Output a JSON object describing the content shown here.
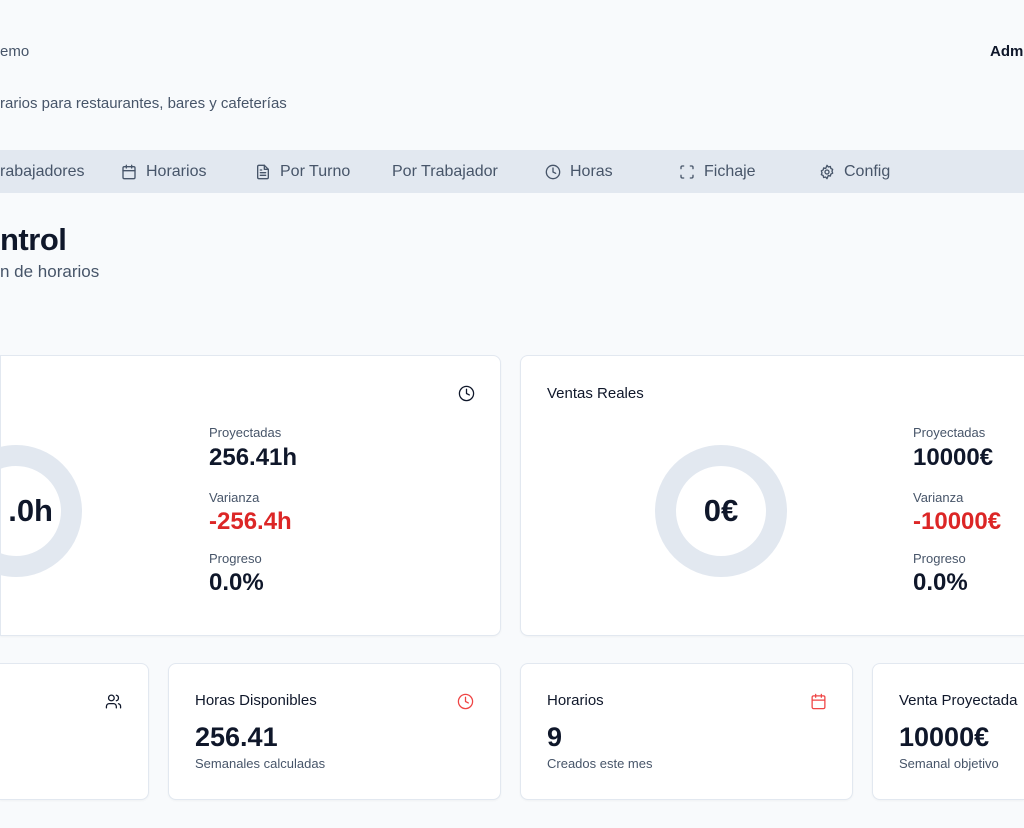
{
  "header": {
    "app_name_fragment": "emo",
    "user_fragment": "Adm",
    "tagline_fragment": "rarios para restaurantes, bares y cafeterías"
  },
  "nav": {
    "items": [
      {
        "label": "rabajadores",
        "icon": "users-icon"
      },
      {
        "label": "Horarios",
        "icon": "calendar-icon"
      },
      {
        "label": "Por Turno",
        "icon": "file-text-icon"
      },
      {
        "label": "Por Trabajador",
        "icon": ""
      },
      {
        "label": "Horas",
        "icon": "clock-icon"
      },
      {
        "label": "Fichaje",
        "icon": "scan-icon"
      },
      {
        "label": "Config",
        "icon": "gear-icon"
      }
    ]
  },
  "page": {
    "title_fragment": "ntrol",
    "subtitle_fragment": "n de horarios"
  },
  "hours_card": {
    "donut_value": ".0h",
    "projected_label": "Proyectadas",
    "projected": "256.41h",
    "variance_label": "Varianza",
    "variance": "-256.4h",
    "progress_label": "Progreso",
    "progress": "0.0%",
    "progress_fraction": 0
  },
  "sales_card": {
    "title": "Ventas Reales",
    "donut_value": "0€",
    "projected_label": "Proyectadas",
    "projected": "10000€",
    "variance_label": "Varianza",
    "variance": "-10000€",
    "progress_label": "Progreso",
    "progress": "0.0%",
    "progress_fraction": 0
  },
  "stats": [
    {
      "title": "",
      "value": "",
      "sub": ""
    },
    {
      "title": "Horas Disponibles",
      "value": "256.41",
      "sub": "Semanales calculadas"
    },
    {
      "title": "Horarios",
      "value": "9",
      "sub": "Creados este mes"
    },
    {
      "title": "Venta Proyectada",
      "value": "10000€",
      "sub": "Semanal objetivo"
    }
  ],
  "colors": {
    "accent_red": "#dc2626",
    "nav_bg": "#e2e8f0",
    "donut_track": "#e2e8f0"
  }
}
